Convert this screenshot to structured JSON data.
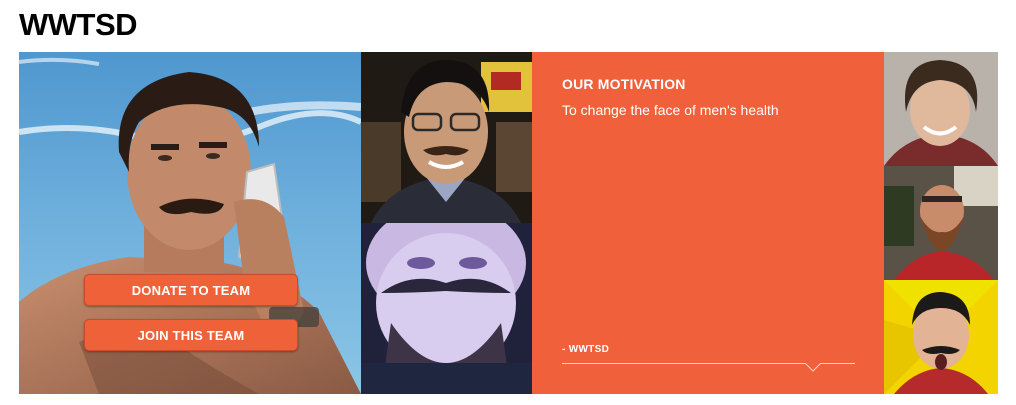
{
  "team": {
    "title": "WWTSD"
  },
  "actions": {
    "donate_label": "DONATE TO TEAM",
    "join_label": "JOIN THIS TEAM"
  },
  "motivation": {
    "heading": "OUR MOTIVATION",
    "text": "To change the face of men's health",
    "attribution": "- WWTSD"
  },
  "colors": {
    "accent": "#f0603a",
    "button": "#ef6139"
  }
}
